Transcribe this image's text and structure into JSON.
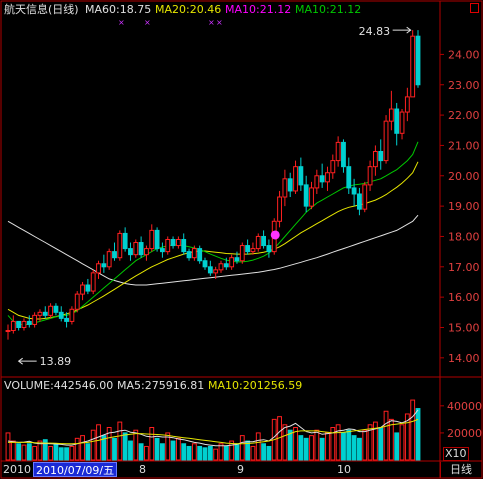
{
  "window": {
    "stock_name": "航天信息(日线)",
    "close_button_icon": "square-icon",
    "tab_label": "日线"
  },
  "price_legend": [
    {
      "label": "MA60:18.75",
      "color": "#e0e0e0"
    },
    {
      "label": "MA20:20.46",
      "color": "#e6e600"
    },
    {
      "label": "MA10:21.12",
      "color": "#ff00ff"
    },
    {
      "label": "MA10:21.12",
      "color": "#00c800"
    }
  ],
  "volume_legend": {
    "volume": {
      "label": "VOLUME:442546.00",
      "color": "#e0e0e0"
    },
    "ma5": {
      "label": "MA5:275916.81",
      "color": "#e0e0e0"
    },
    "ma10": {
      "label": "MA10:201256.59",
      "color": "#e6e600"
    }
  },
  "annotations": {
    "high_label": "24.83",
    "low_label": "13.89"
  },
  "time_axis": {
    "year_label": "2010",
    "cursor_date": "2010/07/09/五",
    "month_labels": [
      "8",
      "9",
      "10"
    ],
    "volume_multiplier": "X10"
  },
  "chart_data": [
    {
      "type": "candlestick",
      "title": "航天信息(日线)",
      "ylim": [
        13.5,
        25.2
      ],
      "y_ticks": [
        14.0,
        15.0,
        16.0,
        17.0,
        18.0,
        19.0,
        20.0,
        21.0,
        22.0,
        23.0,
        24.0
      ],
      "candles": [
        [
          14.9,
          15.1,
          14.6,
          14.9
        ],
        [
          14.9,
          15.4,
          14.8,
          15.2
        ],
        [
          15.2,
          15.2,
          14.9,
          15.0
        ],
        [
          15.0,
          15.3,
          14.9,
          15.2
        ],
        [
          15.2,
          15.4,
          15.0,
          15.1
        ],
        [
          15.1,
          15.5,
          15.0,
          15.4
        ],
        [
          15.4,
          15.6,
          15.2,
          15.5
        ],
        [
          15.5,
          15.7,
          15.3,
          15.4
        ],
        [
          15.4,
          15.8,
          15.3,
          15.7
        ],
        [
          15.7,
          15.8,
          15.4,
          15.5
        ],
        [
          15.5,
          15.7,
          15.2,
          15.3
        ],
        [
          15.3,
          15.5,
          15.0,
          15.2
        ],
        [
          15.2,
          15.7,
          15.1,
          15.6
        ],
        [
          15.6,
          16.2,
          15.5,
          16.1
        ],
        [
          16.1,
          16.5,
          15.9,
          16.4
        ],
        [
          16.4,
          16.6,
          16.1,
          16.2
        ],
        [
          16.2,
          16.9,
          16.1,
          16.8
        ],
        [
          16.8,
          17.2,
          16.6,
          17.1
        ],
        [
          17.1,
          17.4,
          16.8,
          17.0
        ],
        [
          17.0,
          17.6,
          16.9,
          17.5
        ],
        [
          17.5,
          17.8,
          17.2,
          17.3
        ],
        [
          17.3,
          18.2,
          17.2,
          18.1
        ],
        [
          18.1,
          18.3,
          17.5,
          17.6
        ],
        [
          17.6,
          17.8,
          17.2,
          17.4
        ],
        [
          17.4,
          17.9,
          17.3,
          17.8
        ],
        [
          17.8,
          18.0,
          17.3,
          17.4
        ],
        [
          17.4,
          17.7,
          17.2,
          17.6
        ],
        [
          17.6,
          18.4,
          17.5,
          18.2
        ],
        [
          18.2,
          18.3,
          17.5,
          17.6
        ],
        [
          17.6,
          17.8,
          17.3,
          17.5
        ],
        [
          17.5,
          18.0,
          17.4,
          17.9
        ],
        [
          17.9,
          18.0,
          17.6,
          17.7
        ],
        [
          17.7,
          18.0,
          17.6,
          17.9
        ],
        [
          17.9,
          18.1,
          17.4,
          17.5
        ],
        [
          17.5,
          17.6,
          17.2,
          17.3
        ],
        [
          17.3,
          17.7,
          17.2,
          17.6
        ],
        [
          17.6,
          17.7,
          17.1,
          17.2
        ],
        [
          17.2,
          17.3,
          16.9,
          17.0
        ],
        [
          17.0,
          17.2,
          16.7,
          16.8
        ],
        [
          16.8,
          17.0,
          16.6,
          16.9
        ],
        [
          16.9,
          17.2,
          16.8,
          17.1
        ],
        [
          17.1,
          17.3,
          16.9,
          17.0
        ],
        [
          17.0,
          17.4,
          16.9,
          17.3
        ],
        [
          17.3,
          17.5,
          17.1,
          17.2
        ],
        [
          17.2,
          17.8,
          17.1,
          17.7
        ],
        [
          17.7,
          17.9,
          17.4,
          17.5
        ],
        [
          17.5,
          17.8,
          17.4,
          17.6
        ],
        [
          17.6,
          18.1,
          17.5,
          18.0
        ],
        [
          18.0,
          18.2,
          17.6,
          17.7
        ],
        [
          17.7,
          17.9,
          17.3,
          17.5
        ],
        [
          17.5,
          18.6,
          17.4,
          18.5
        ],
        [
          18.5,
          19.5,
          18.3,
          19.3
        ],
        [
          19.3,
          20.2,
          19.0,
          19.9
        ],
        [
          19.9,
          20.1,
          19.3,
          19.5
        ],
        [
          19.5,
          20.5,
          19.4,
          20.3
        ],
        [
          20.3,
          20.6,
          19.5,
          19.7
        ],
        [
          19.7,
          20.0,
          18.8,
          19.0
        ],
        [
          19.0,
          19.8,
          18.9,
          19.6
        ],
        [
          19.6,
          20.2,
          19.4,
          20.0
        ],
        [
          20.0,
          20.4,
          19.6,
          19.8
        ],
        [
          19.8,
          20.3,
          19.5,
          20.1
        ],
        [
          20.1,
          20.7,
          19.9,
          20.5
        ],
        [
          20.5,
          21.3,
          20.3,
          21.1
        ],
        [
          21.1,
          21.2,
          20.1,
          20.3
        ],
        [
          20.3,
          20.6,
          19.4,
          19.6
        ],
        [
          19.6,
          19.9,
          19.0,
          19.4
        ],
        [
          19.4,
          19.6,
          18.7,
          18.9
        ],
        [
          18.9,
          19.8,
          18.8,
          19.7
        ],
        [
          19.7,
          20.5,
          19.5,
          20.3
        ],
        [
          20.3,
          21.0,
          20.0,
          20.8
        ],
        [
          20.8,
          21.2,
          20.2,
          20.5
        ],
        [
          20.5,
          22.0,
          20.4,
          21.8
        ],
        [
          21.8,
          22.8,
          21.5,
          22.2
        ],
        [
          22.2,
          22.4,
          21.0,
          21.4
        ],
        [
          21.4,
          22.2,
          21.2,
          22.1
        ],
        [
          22.1,
          22.9,
          21.8,
          22.6
        ],
        [
          22.6,
          24.8,
          22.6,
          24.6
        ],
        [
          24.6,
          24.8,
          22.9,
          23.0
        ]
      ],
      "series": [
        {
          "name": "MA60",
          "color": "#e0e0e0",
          "values": [
            18.5,
            18.4,
            18.3,
            18.2,
            18.1,
            18.0,
            17.9,
            17.8,
            17.7,
            17.6,
            17.5,
            17.4,
            17.3,
            17.2,
            17.1,
            17.0,
            16.9,
            16.8,
            16.7,
            16.6,
            16.55,
            16.5,
            16.45,
            16.42,
            16.4,
            16.4,
            16.4,
            16.42,
            16.44,
            16.46,
            16.48,
            16.5,
            16.52,
            16.54,
            16.56,
            16.58,
            16.6,
            16.62,
            16.64,
            16.66,
            16.68,
            16.7,
            16.72,
            16.74,
            16.76,
            16.78,
            16.8,
            16.82,
            16.85,
            16.88,
            16.91,
            16.95,
            17.0,
            17.05,
            17.1,
            17.15,
            17.2,
            17.25,
            17.3,
            17.36,
            17.42,
            17.48,
            17.54,
            17.6,
            17.66,
            17.72,
            17.78,
            17.84,
            17.9,
            17.96,
            18.02,
            18.08,
            18.14,
            18.2,
            18.3,
            18.4,
            18.5,
            18.7
          ]
        },
        {
          "name": "MA20",
          "color": "#e6e600",
          "values": [
            15.6,
            15.5,
            15.4,
            15.35,
            15.3,
            15.28,
            15.28,
            15.3,
            15.33,
            15.36,
            15.4,
            15.45,
            15.5,
            15.58,
            15.66,
            15.74,
            15.84,
            15.94,
            16.04,
            16.15,
            16.26,
            16.37,
            16.48,
            16.59,
            16.7,
            16.8,
            16.9,
            17.0,
            17.08,
            17.16,
            17.24,
            17.3,
            17.36,
            17.42,
            17.46,
            17.5,
            17.52,
            17.52,
            17.5,
            17.48,
            17.46,
            17.44,
            17.43,
            17.42,
            17.42,
            17.42,
            17.43,
            17.45,
            17.48,
            17.52,
            17.58,
            17.66,
            17.76,
            17.88,
            18.0,
            18.12,
            18.22,
            18.32,
            18.42,
            18.52,
            18.62,
            18.72,
            18.82,
            18.9,
            18.96,
            19.0,
            19.04,
            19.08,
            19.14,
            19.2,
            19.28,
            19.38,
            19.5,
            19.62,
            19.76,
            19.92,
            20.1,
            20.46
          ]
        },
        {
          "name": "MA10",
          "color": "#00c800",
          "values": [
            15.4,
            15.2,
            15.1,
            15.1,
            15.1,
            15.15,
            15.2,
            15.25,
            15.3,
            15.35,
            15.38,
            15.4,
            15.45,
            15.55,
            15.7,
            15.85,
            16.0,
            16.15,
            16.3,
            16.45,
            16.6,
            16.75,
            16.9,
            17.05,
            17.2,
            17.3,
            17.4,
            17.5,
            17.6,
            17.65,
            17.7,
            17.72,
            17.72,
            17.7,
            17.66,
            17.62,
            17.57,
            17.5,
            17.42,
            17.35,
            17.28,
            17.22,
            17.18,
            17.16,
            17.16,
            17.18,
            17.22,
            17.28,
            17.35,
            17.45,
            17.6,
            17.8,
            18.0,
            18.2,
            18.4,
            18.6,
            18.8,
            18.95,
            19.1,
            19.2,
            19.3,
            19.4,
            19.5,
            19.6,
            19.65,
            19.7,
            19.72,
            19.75,
            19.8,
            19.85,
            19.9,
            20.0,
            20.1,
            20.2,
            20.35,
            20.5,
            20.7,
            21.12
          ]
        }
      ]
    },
    {
      "type": "bar",
      "title": "VOLUME",
      "ylim": [
        0,
        48000
      ],
      "y_ticks": [
        20000,
        40000
      ],
      "values": [
        20000,
        14000,
        12000,
        11000,
        12000,
        10000,
        14000,
        15000,
        10000,
        12000,
        9000,
        9000,
        10000,
        16000,
        18000,
        12000,
        22000,
        26000,
        18000,
        24000,
        16000,
        28000,
        20000,
        14000,
        22000,
        12000,
        10000,
        24000,
        16000,
        12000,
        20000,
        14000,
        16000,
        12000,
        10000,
        12000,
        10000,
        9000,
        10000,
        8000,
        12000,
        10000,
        14000,
        12000,
        18000,
        14000,
        10000,
        20000,
        12000,
        10000,
        30000,
        32000,
        26000,
        22000,
        24000,
        18000,
        16000,
        18000,
        22000,
        16000,
        20000,
        24000,
        26000,
        20000,
        22000,
        18000,
        16000,
        22000,
        26000,
        28000,
        24000,
        36000,
        30000,
        20000,
        26000,
        34000,
        44254,
        38000
      ],
      "series": [
        {
          "name": "MA5",
          "color": "#e0e0e0",
          "values": [
            14000,
            13500,
            13000,
            13200,
            13800,
            12500,
            12000,
            12200,
            12000,
            11800,
            11500,
            11000,
            11000,
            12000,
            13000,
            14000,
            15500,
            17000,
            18500,
            20000,
            20500,
            21500,
            22000,
            20500,
            20000,
            19000,
            17500,
            17000,
            17500,
            17000,
            17000,
            16500,
            15500,
            15000,
            14000,
            13000,
            12500,
            11500,
            11000,
            10500,
            10500,
            10500,
            11000,
            11500,
            13000,
            13500,
            13500,
            14500,
            15000,
            14000,
            17000,
            21000,
            24000,
            25000,
            27000,
            24000,
            21000,
            20000,
            20500,
            19000,
            19500,
            20000,
            21500,
            22000,
            23000,
            22500,
            21000,
            21000,
            22000,
            23000,
            24000,
            27000,
            29000,
            28500,
            27500,
            29000,
            32000,
            37000
          ]
        },
        {
          "name": "MA10",
          "color": "#e6e600",
          "values": [
            13000,
            13000,
            13000,
            13000,
            13000,
            12800,
            12600,
            12500,
            12500,
            12300,
            12100,
            12000,
            12000,
            12200,
            12600,
            13000,
            13800,
            14500,
            15500,
            16500,
            17200,
            17800,
            18500,
            19000,
            19500,
            19500,
            19200,
            19000,
            18800,
            18500,
            18200,
            17500,
            17000,
            16500,
            16000,
            15500,
            15000,
            14500,
            14000,
            13500,
            13000,
            12500,
            12200,
            12000,
            12000,
            12200,
            12500,
            13000,
            13500,
            14000,
            15000,
            16500,
            18000,
            19500,
            21000,
            21500,
            21500,
            21500,
            21500,
            21000,
            20500,
            20000,
            20200,
            20500,
            21000,
            21500,
            22000,
            22500,
            23000,
            23500,
            24000,
            25000,
            26000,
            26500,
            27000,
            27500,
            28500,
            30000
          ]
        }
      ]
    }
  ]
}
